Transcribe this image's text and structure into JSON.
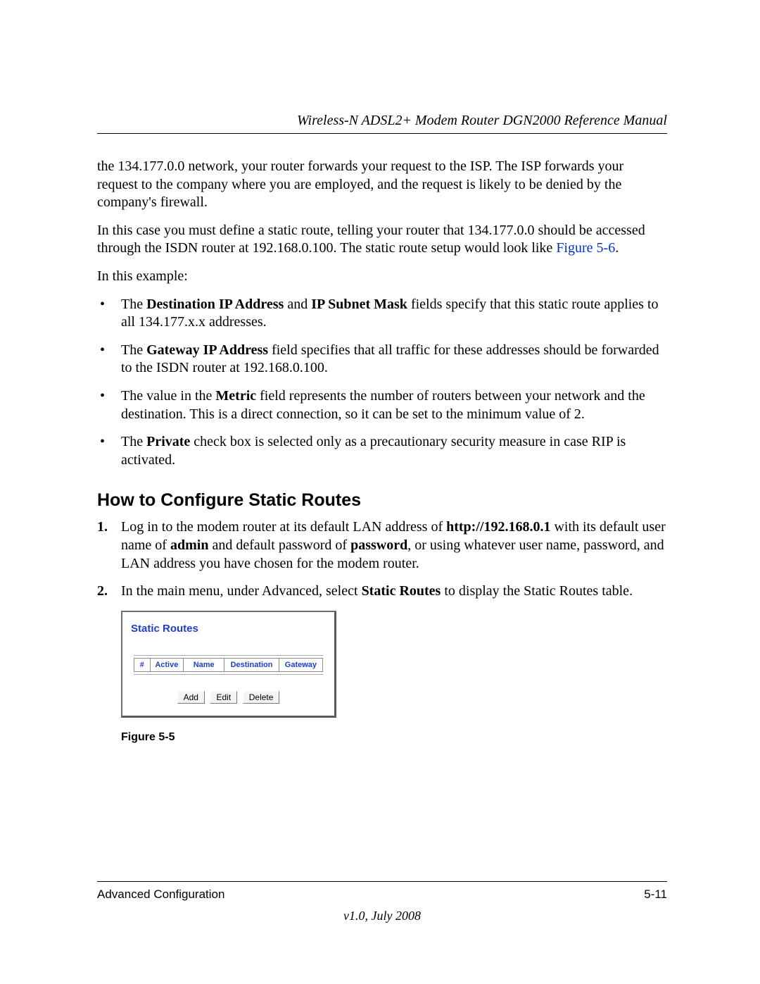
{
  "header": {
    "title": "Wireless-N ADSL2+ Modem Router DGN2000 Reference Manual"
  },
  "body": {
    "p1": "the 134.177.0.0 network, your router forwards your request to the ISP. The ISP forwards your request to the company where you are employed, and the request is likely to be denied by the company's firewall.",
    "p2_pre": "In this case you must define a static route, telling your router that 134.177.0.0 should be accessed through the ISDN router at 192.168.0.100. The static route setup would look like ",
    "p2_link": "Figure 5-6",
    "p2_post": ".",
    "p3": "In this example:",
    "bullets": {
      "b1_pre": "The ",
      "b1_b1": "Destination IP Address",
      "b1_mid": " and ",
      "b1_b2": "IP Subnet Mask",
      "b1_post": " fields specify that this static route applies to all 134.177.x.x addresses.",
      "b2_pre": "The ",
      "b2_b1": "Gateway IP Address",
      "b2_post": " field specifies that all traffic for these addresses should be forwarded to the ISDN router at 192.168.0.100.",
      "b3_pre": "The value in the ",
      "b3_b1": "Metric",
      "b3_post": " field represents the number of routers between your network and the destination. This is a direct connection, so it can be set to the minimum value of 2.",
      "b4_pre": "The ",
      "b4_b1": "Private",
      "b4_post": " check box is selected only as a precautionary security measure in case RIP is activated."
    },
    "subhead": "How to Configure Static Routes",
    "steps": {
      "s1_pre": "Log in to the modem router at its default LAN address of ",
      "s1_b1": "http://192.168.0.1",
      "s1_mid1": " with its default user name of ",
      "s1_b2": "admin",
      "s1_mid2": " and default password of ",
      "s1_b3": "password",
      "s1_post": ", or using whatever user name, password, and LAN address you have chosen for the modem router.",
      "s2_pre": "In the main menu, under Advanced, select ",
      "s2_b1": "Static Routes",
      "s2_post": " to display the Static Routes table."
    },
    "screenshot": {
      "title": "Static Routes",
      "headers": {
        "num": "#",
        "active": "Active",
        "name": "Name",
        "dest": "Destination",
        "gw": "Gateway"
      },
      "buttons": {
        "add": "Add",
        "edit": "Edit",
        "delete": "Delete"
      }
    },
    "figure_caption": "Figure 5-5"
  },
  "footer": {
    "left": "Advanced Configuration",
    "right": "5-11",
    "version": "v1.0, July 2008"
  }
}
